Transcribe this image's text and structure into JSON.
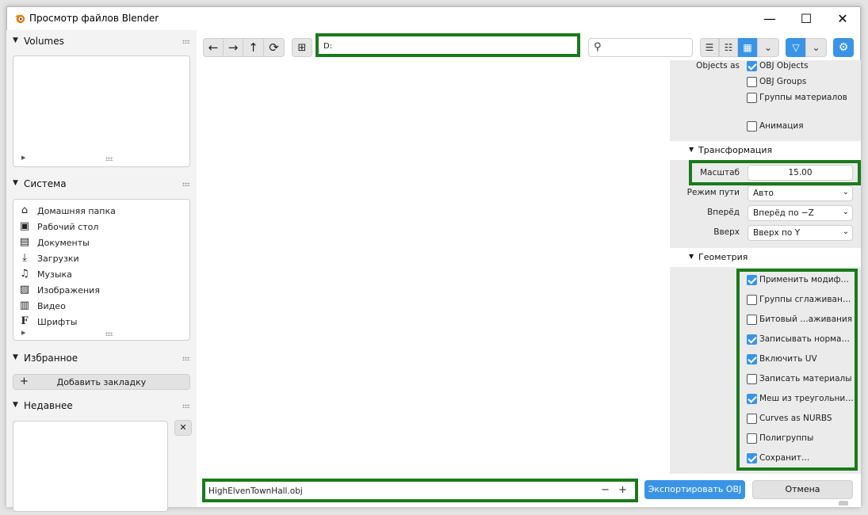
{
  "window": {
    "title": "Просмотр файлов Blender",
    "minimize": "—",
    "maximize": "☐",
    "close": "✕"
  },
  "sidebar": {
    "volumes": {
      "title": "Volumes"
    },
    "system": {
      "title": "Система",
      "items": [
        {
          "label": "Домашняя папка",
          "icon": "home-icon",
          "glyph": "⌂"
        },
        {
          "label": "Рабочий стол",
          "icon": "desktop-icon",
          "glyph": "▣"
        },
        {
          "label": "Документы",
          "icon": "documents-icon",
          "glyph": "▤"
        },
        {
          "label": "Загрузки",
          "icon": "download-icon",
          "glyph": "⤓"
        },
        {
          "label": "Музыка",
          "icon": "music-icon",
          "glyph": "♫"
        },
        {
          "label": "Изображения",
          "icon": "image-icon",
          "glyph": "▨"
        },
        {
          "label": "Видео",
          "icon": "video-icon",
          "glyph": "▥"
        },
        {
          "label": "Шрифты",
          "icon": "font-icon",
          "glyph": "F"
        }
      ]
    },
    "favorites": {
      "title": "Избранное",
      "add_bookmark": "Добавить закладку",
      "plus": "+"
    },
    "recent": {
      "title": "Недавнее",
      "clear": "✕"
    }
  },
  "toolbar": {
    "back": "←",
    "forward": "→",
    "parent": "↑",
    "refresh": "⟳",
    "new_folder": "⊞",
    "path": "D:",
    "search_placeholder": "",
    "search_glyph": "⚲",
    "view_vertical_list": "☰",
    "view_horizontal_list": "☷",
    "view_thumbnails": "▦",
    "view_dropdown": "⌄",
    "filter": "▽",
    "filter_dropdown": "⌄",
    "settings": "⚙"
  },
  "panel": {
    "objects_as_label": "Objects as",
    "objects_as_options": [
      {
        "label": "OBJ Objects",
        "checked": true
      },
      {
        "label": "OBJ Groups",
        "checked": false
      },
      {
        "label": "Группы материалов",
        "checked": false
      }
    ],
    "animation": {
      "label": "Анимация",
      "checked": false
    },
    "transform": {
      "title": "Трансформация",
      "scale_label": "Масштаб",
      "scale_value": "15.00",
      "path_mode_label": "Режим пути",
      "path_mode_value": "Авто",
      "forward_label": "Вперёд",
      "forward_value": "Вперёд по −Z",
      "up_label": "Вверх",
      "up_value": "Вверх по Y"
    },
    "geometry": {
      "title": "Геометрия",
      "options": [
        {
          "label": "Применить модиф…",
          "checked": true
        },
        {
          "label": "Группы сглаживан…",
          "checked": false
        },
        {
          "label": "Битовый …аживания",
          "checked": false
        },
        {
          "label": "Записывать норма…",
          "checked": true
        },
        {
          "label": "Включить UV",
          "checked": true
        },
        {
          "label": "Записать материалы",
          "checked": false
        },
        {
          "label": "Меш из треугольни…",
          "checked": true
        },
        {
          "label": "Curves as NURBS",
          "checked": false
        },
        {
          "label": "Полигруппы",
          "checked": false
        },
        {
          "label": "Сохранит…",
          "checked": true
        }
      ]
    }
  },
  "bottom": {
    "filename": "HighElvenTownHall.obj",
    "decrement": "−",
    "increment": "+",
    "export_label": "Экспортировать OBJ",
    "cancel_label": "Отмена"
  },
  "colors": {
    "accent": "#3a94e6",
    "highlight_green": "#1a7a1a",
    "panel_bg": "#ebebeb",
    "sidebar_bg": "#f3f3f3"
  }
}
